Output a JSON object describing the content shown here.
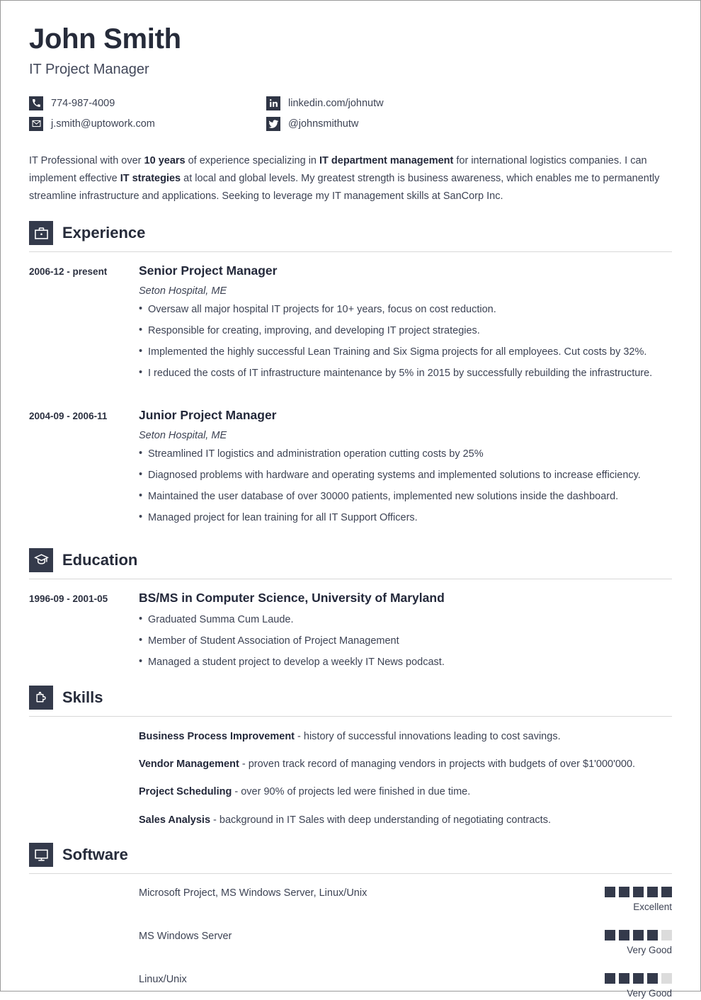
{
  "colors": {
    "ink": "#262b3a",
    "body": "#3d4354",
    "icon_box": "#343a4b",
    "pip_on": "#343a4b",
    "pip_off": "#dcdcdc",
    "rule": "#d8d8d8",
    "page_border": "#9a9a9a"
  },
  "header": {
    "name": "John Smith",
    "job_title": "IT Project Manager",
    "contacts": [
      {
        "icon": "phone-icon",
        "value": "774-987-4009"
      },
      {
        "icon": "linkedin-icon",
        "value": "linkedin.com/johnutw"
      },
      {
        "icon": "envelope-icon",
        "value": "j.smith@uptowork.com"
      },
      {
        "icon": "twitter-icon",
        "value": "@johnsmithutw"
      }
    ]
  },
  "summary": {
    "parts": [
      {
        "text": "IT Professional with over ",
        "bold": false
      },
      {
        "text": "10 years",
        "bold": true
      },
      {
        "text": " of experience specializing in ",
        "bold": false
      },
      {
        "text": "IT department management",
        "bold": true
      },
      {
        "text": " for international logistics companies. I can implement effective ",
        "bold": false
      },
      {
        "text": "IT strategies",
        "bold": true
      },
      {
        "text": " at local and global levels. My greatest strength is business awareness, which enables me to permanently streamline infrastructure and applications. Seeking to leverage my IT management skills at SanCorp Inc.",
        "bold": false
      }
    ]
  },
  "sections": {
    "experience": {
      "title": "Experience",
      "icon": "briefcase-icon",
      "entries": [
        {
          "date": "2006-12 - present",
          "title": "Senior Project Manager",
          "subtitle": "Seton Hospital, ME",
          "bullets": [
            "Oversaw all major hospital IT projects for 10+ years, focus on cost reduction.",
            "Responsible for creating, improving, and developing IT project strategies.",
            "Implemented the highly successful Lean Training and Six Sigma projects for all employees. Cut costs by 32%.",
            "I reduced the costs of IT infrastructure maintenance by 5% in 2015 by successfully rebuilding the infrastructure."
          ]
        },
        {
          "date": "2004-09 - 2006-11",
          "title": "Junior Project Manager",
          "subtitle": "Seton Hospital, ME",
          "bullets": [
            "Streamlined IT logistics and administration operation cutting costs by 25%",
            "Diagnosed problems with hardware and operating systems and implemented solutions to increase efficiency.",
            "Maintained the user database of over 30000 patients, implemented new solutions inside the dashboard.",
            "Managed project for lean training for all IT Support Officers."
          ]
        }
      ]
    },
    "education": {
      "title": "Education",
      "icon": "graduation-cap-icon",
      "entries": [
        {
          "date": "1996-09 - 2001-05",
          "title": "BS/MS in Computer Science, University of Maryland",
          "bullets": [
            "Graduated Summa Cum Laude.",
            "Member of Student Association of Project Management",
            "Managed a student project to develop a weekly IT News podcast."
          ]
        }
      ]
    },
    "skills": {
      "title": "Skills",
      "icon": "puzzle-piece-icon",
      "items": [
        {
          "name": "Business Process Improvement",
          "description": " - history of successful innovations leading to cost savings."
        },
        {
          "name": "Vendor Management",
          "description": " - proven track record of managing vendors in projects with budgets of over $1'000'000."
        },
        {
          "name": "Project Scheduling",
          "description": " - over 90% of projects led were finished in due time."
        },
        {
          "name": "Sales Analysis",
          "description": " - background in IT Sales with deep understanding of negotiating contracts."
        }
      ]
    },
    "software": {
      "title": "Software",
      "icon": "monitor-icon",
      "max_rating": 5,
      "rows": [
        {
          "name": "Microsoft Project, MS Windows Server, Linux/Unix",
          "rating": 5,
          "label": "Excellent"
        },
        {
          "name": "MS Windows Server",
          "rating": 4,
          "label": "Very Good"
        },
        {
          "name": "Linux/Unix",
          "rating": 4,
          "label": "Very Good"
        }
      ]
    }
  }
}
